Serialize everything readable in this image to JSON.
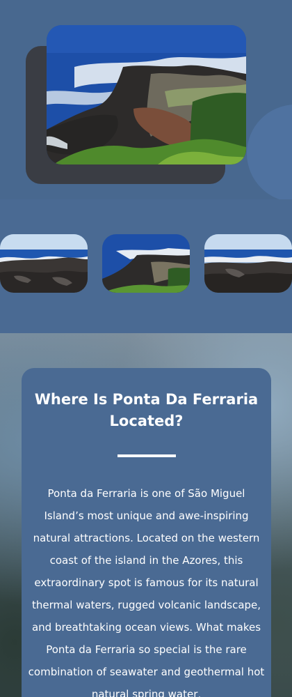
{
  "section": {
    "title": "Where Is Ponta Da Ferraria Located?",
    "body": "Ponta da Ferraria is one of São Miguel Island’s most unique and awe-inspiring natural attractions. Located on the western coast of the island in the Azores, this extraordinary spot is famous for its natural thermal waters, rugged volcanic landscape, and breathtaking ocean views. What makes Ponta da Ferraria so special is the rare combination of seawater and geothermal hot natural spring water,"
  },
  "colors": {
    "page_blue": "#4a6a93",
    "card_blue": "#4a6a93",
    "shadow": "#3a3d44",
    "text": "#ffffff"
  }
}
